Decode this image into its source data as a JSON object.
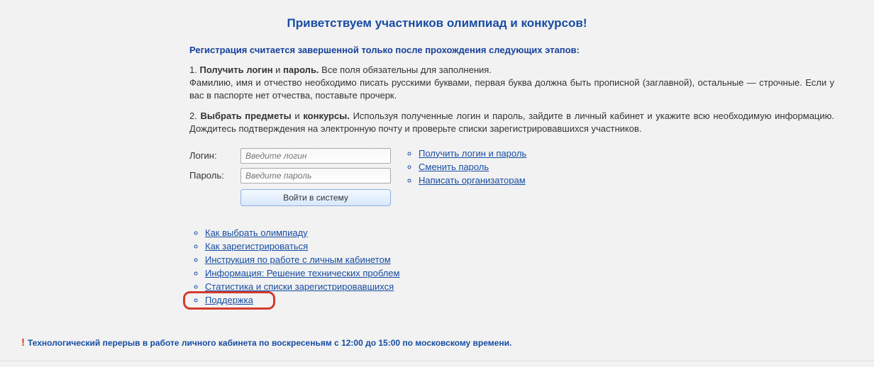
{
  "heading": "Приветствуем участников олимпиад и конкурсов!",
  "subheading": "Регистрация считается завершенной только после прохождения следующих этапов:",
  "step1": {
    "prefix": "1. ",
    "bold1": "Получить логин",
    "mid1": " и ",
    "bold2": "пароль.",
    "rest1": " Все поля обязательны для заполнения.",
    "line2": "Фамилию, имя и отчество необходимо писать русскими буквами, первая буква должна быть прописной (заглавной), остальные — строчные. Если у вас в паспорте нет отчества, поставьте прочерк."
  },
  "step2": {
    "prefix": "2. ",
    "bold1": "Выбрать предметы",
    "mid1": " и ",
    "bold2": "конкурсы.",
    "rest": " Используя полученные логин и пароль, зайдите в личный кабинет и укажите всю необходимую информацию. Дождитесь подтверждения на электронную почту и проверьте списки зарегистрировавшихся участников."
  },
  "form": {
    "login_label": "Логин:",
    "login_placeholder": "Введите логин",
    "password_label": "Пароль:",
    "password_placeholder": "Введите пароль",
    "submit_label": "Войти в систему"
  },
  "action_links": [
    "Получить логин и пароль",
    "Сменить пароль",
    "Написать организаторам"
  ],
  "help_links": [
    "Как выбрать олимпиаду",
    "Как зарегистрироваться",
    "Инструкция по работе с личным кабинетом",
    "Информация: Решение технических проблем",
    "Статистика и списки зарегистрировавшихся",
    "Поддержка"
  ],
  "footer_notice": "Технологический перерыв в работе личного кабинета по воскресеньям с 12:00 до 15:00 по московскому времени."
}
